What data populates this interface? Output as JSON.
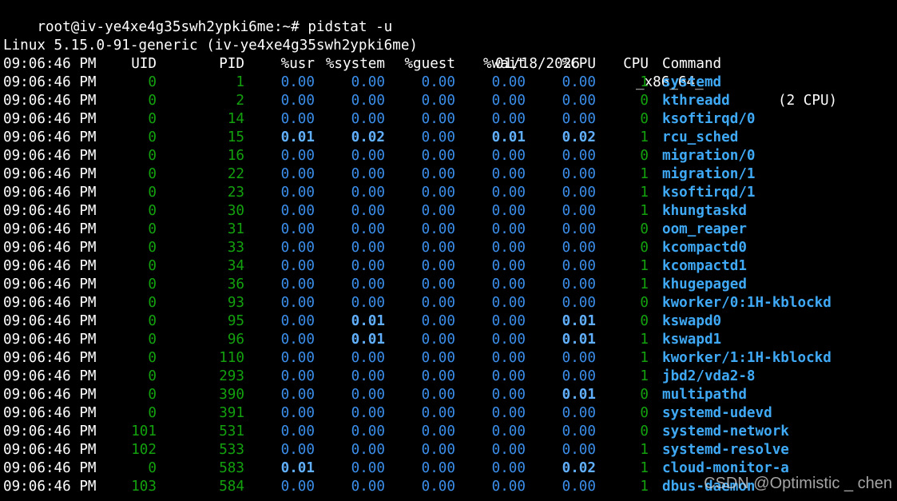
{
  "terminal": {
    "prompt": "root@iv-ye4xe4g35swh2ypki6me:~# ",
    "command": "pidstat -u",
    "sysinfo": {
      "kernel": "Linux 5.15.0-91-generic (iv-ye4xe4g35swh2ypki6me)",
      "date": "01/18/2026",
      "arch": "_x86_64_",
      "cpus": "(2 CPU)"
    },
    "columns": {
      "time": "09:06:46 PM",
      "uid": "UID",
      "pid": "PID",
      "usr": "%usr",
      "system": "%system",
      "guest": "%guest",
      "wait": "%wait",
      "cpu_pct": "%CPU",
      "cpu": "CPU",
      "command": "Command"
    },
    "rows": [
      {
        "time": "09:06:46 PM",
        "uid": "0",
        "pid": "1",
        "usr": "0.00",
        "system": "0.00",
        "guest": "0.00",
        "wait": "0.00",
        "cpu_pct": "0.00",
        "cpu": "1",
        "command": "systemd"
      },
      {
        "time": "09:06:46 PM",
        "uid": "0",
        "pid": "2",
        "usr": "0.00",
        "system": "0.00",
        "guest": "0.00",
        "wait": "0.00",
        "cpu_pct": "0.00",
        "cpu": "0",
        "command": "kthreadd"
      },
      {
        "time": "09:06:46 PM",
        "uid": "0",
        "pid": "14",
        "usr": "0.00",
        "system": "0.00",
        "guest": "0.00",
        "wait": "0.00",
        "cpu_pct": "0.00",
        "cpu": "0",
        "command": "ksoftirqd/0"
      },
      {
        "time": "09:06:46 PM",
        "uid": "0",
        "pid": "15",
        "usr": "0.01",
        "system": "0.02",
        "guest": "0.00",
        "wait": "0.01",
        "cpu_pct": "0.02",
        "cpu": "1",
        "command": "rcu_sched"
      },
      {
        "time": "09:06:46 PM",
        "uid": "0",
        "pid": "16",
        "usr": "0.00",
        "system": "0.00",
        "guest": "0.00",
        "wait": "0.00",
        "cpu_pct": "0.00",
        "cpu": "0",
        "command": "migration/0"
      },
      {
        "time": "09:06:46 PM",
        "uid": "0",
        "pid": "22",
        "usr": "0.00",
        "system": "0.00",
        "guest": "0.00",
        "wait": "0.00",
        "cpu_pct": "0.00",
        "cpu": "1",
        "command": "migration/1"
      },
      {
        "time": "09:06:46 PM",
        "uid": "0",
        "pid": "23",
        "usr": "0.00",
        "system": "0.00",
        "guest": "0.00",
        "wait": "0.00",
        "cpu_pct": "0.00",
        "cpu": "1",
        "command": "ksoftirqd/1"
      },
      {
        "time": "09:06:46 PM",
        "uid": "0",
        "pid": "30",
        "usr": "0.00",
        "system": "0.00",
        "guest": "0.00",
        "wait": "0.00",
        "cpu_pct": "0.00",
        "cpu": "1",
        "command": "khungtaskd"
      },
      {
        "time": "09:06:46 PM",
        "uid": "0",
        "pid": "31",
        "usr": "0.00",
        "system": "0.00",
        "guest": "0.00",
        "wait": "0.00",
        "cpu_pct": "0.00",
        "cpu": "0",
        "command": "oom_reaper"
      },
      {
        "time": "09:06:46 PM",
        "uid": "0",
        "pid": "33",
        "usr": "0.00",
        "system": "0.00",
        "guest": "0.00",
        "wait": "0.00",
        "cpu_pct": "0.00",
        "cpu": "0",
        "command": "kcompactd0"
      },
      {
        "time": "09:06:46 PM",
        "uid": "0",
        "pid": "34",
        "usr": "0.00",
        "system": "0.00",
        "guest": "0.00",
        "wait": "0.00",
        "cpu_pct": "0.00",
        "cpu": "1",
        "command": "kcompactd1"
      },
      {
        "time": "09:06:46 PM",
        "uid": "0",
        "pid": "36",
        "usr": "0.00",
        "system": "0.00",
        "guest": "0.00",
        "wait": "0.00",
        "cpu_pct": "0.00",
        "cpu": "1",
        "command": "khugepaged"
      },
      {
        "time": "09:06:46 PM",
        "uid": "0",
        "pid": "93",
        "usr": "0.00",
        "system": "0.00",
        "guest": "0.00",
        "wait": "0.00",
        "cpu_pct": "0.00",
        "cpu": "0",
        "command": "kworker/0:1H-kblockd"
      },
      {
        "time": "09:06:46 PM",
        "uid": "0",
        "pid": "95",
        "usr": "0.00",
        "system": "0.01",
        "guest": "0.00",
        "wait": "0.00",
        "cpu_pct": "0.01",
        "cpu": "0",
        "command": "kswapd0"
      },
      {
        "time": "09:06:46 PM",
        "uid": "0",
        "pid": "96",
        "usr": "0.00",
        "system": "0.01",
        "guest": "0.00",
        "wait": "0.00",
        "cpu_pct": "0.01",
        "cpu": "1",
        "command": "kswapd1"
      },
      {
        "time": "09:06:46 PM",
        "uid": "0",
        "pid": "110",
        "usr": "0.00",
        "system": "0.00",
        "guest": "0.00",
        "wait": "0.00",
        "cpu_pct": "0.00",
        "cpu": "1",
        "command": "kworker/1:1H-kblockd"
      },
      {
        "time": "09:06:46 PM",
        "uid": "0",
        "pid": "293",
        "usr": "0.00",
        "system": "0.00",
        "guest": "0.00",
        "wait": "0.00",
        "cpu_pct": "0.00",
        "cpu": "1",
        "command": "jbd2/vda2-8"
      },
      {
        "time": "09:06:46 PM",
        "uid": "0",
        "pid": "390",
        "usr": "0.00",
        "system": "0.00",
        "guest": "0.00",
        "wait": "0.00",
        "cpu_pct": "0.01",
        "cpu": "0",
        "command": "multipathd"
      },
      {
        "time": "09:06:46 PM",
        "uid": "0",
        "pid": "391",
        "usr": "0.00",
        "system": "0.00",
        "guest": "0.00",
        "wait": "0.00",
        "cpu_pct": "0.00",
        "cpu": "0",
        "command": "systemd-udevd"
      },
      {
        "time": "09:06:46 PM",
        "uid": "101",
        "pid": "531",
        "usr": "0.00",
        "system": "0.00",
        "guest": "0.00",
        "wait": "0.00",
        "cpu_pct": "0.00",
        "cpu": "0",
        "command": "systemd-network"
      },
      {
        "time": "09:06:46 PM",
        "uid": "102",
        "pid": "533",
        "usr": "0.00",
        "system": "0.00",
        "guest": "0.00",
        "wait": "0.00",
        "cpu_pct": "0.00",
        "cpu": "1",
        "command": "systemd-resolve"
      },
      {
        "time": "09:06:46 PM",
        "uid": "0",
        "pid": "583",
        "usr": "0.01",
        "system": "0.00",
        "guest": "0.00",
        "wait": "0.00",
        "cpu_pct": "0.02",
        "cpu": "1",
        "command": "cloud-monitor-a"
      },
      {
        "time": "09:06:46 PM",
        "uid": "103",
        "pid": "584",
        "usr": "0.00",
        "system": "0.00",
        "guest": "0.00",
        "wait": "0.00",
        "cpu_pct": "0.00",
        "cpu": "1",
        "command": "dbus-daemon"
      }
    ]
  },
  "watermark": "CSDN @Optimistic _ chen",
  "colors": {
    "background": "#000000",
    "text": "#ffffff",
    "id_green": "#13a10e",
    "value_blue": "#3b8eea",
    "nonzero_blue": "#61b0ff",
    "command_blue": "#3fa9f5"
  }
}
